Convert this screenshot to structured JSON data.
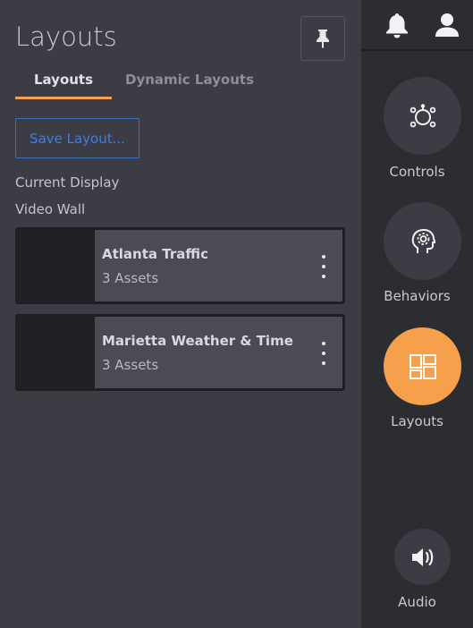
{
  "panel": {
    "title": "Layouts",
    "pin_icon": "pin-icon"
  },
  "tabs": [
    {
      "label": "Layouts",
      "active": true
    },
    {
      "label": "Dynamic Layouts",
      "active": false
    }
  ],
  "save_button_label": "Save Layout...",
  "current_display_label": "Current Display",
  "video_wall_label": "Video Wall",
  "layouts": [
    {
      "name": "Atlanta Traffic",
      "assets": "3 Assets"
    },
    {
      "name": "Marietta Weather & Time",
      "assets": "3 Assets"
    }
  ],
  "rail": {
    "top_icons": [
      "bell-icon",
      "user-icon"
    ],
    "items": [
      {
        "label": "Controls",
        "icon": "controls-icon",
        "active": false
      },
      {
        "label": "Behaviors",
        "icon": "brain-gear-icon",
        "active": false
      },
      {
        "label": "Layouts",
        "icon": "layouts-icon",
        "active": true
      },
      {
        "label": "Audio",
        "icon": "speaker-icon",
        "active": false
      }
    ]
  },
  "colors": {
    "accent": "#f7a04b",
    "link": "#3f7ee0",
    "panel_bg": "#3b3c44",
    "rail_bg": "#2c2d31"
  }
}
